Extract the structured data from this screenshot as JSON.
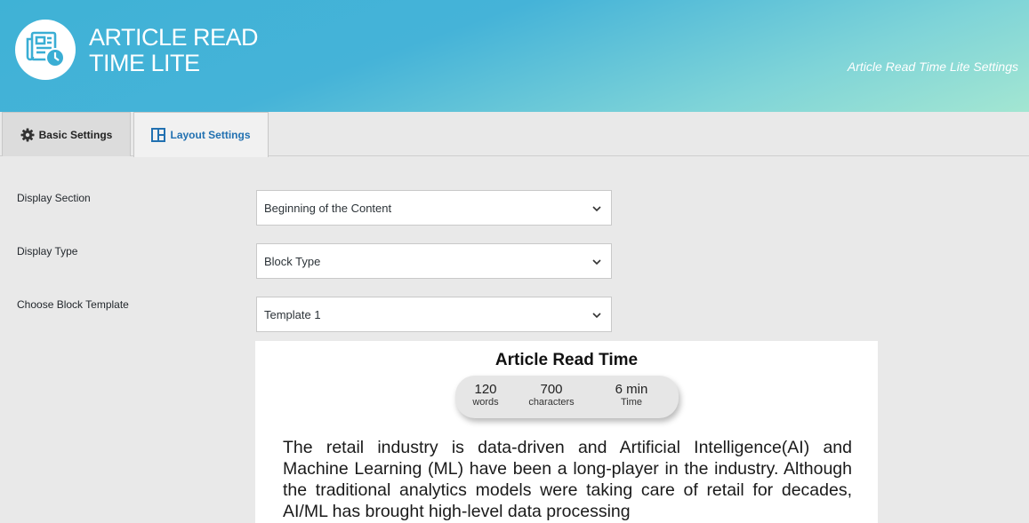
{
  "header": {
    "app_title_line1": "ARTICLE READ",
    "app_title_line2": "TIME LITE",
    "subtitle": "Article Read Time Lite Settings",
    "logo_icon": "newspaper-clock-icon"
  },
  "tabs": [
    {
      "label": "Basic Settings",
      "icon": "gear-icon",
      "active": false
    },
    {
      "label": "Layout Settings",
      "icon": "layout-icon",
      "active": true
    }
  ],
  "form": {
    "display_section": {
      "label": "Display Section",
      "value": "Beginning of the Content"
    },
    "display_type": {
      "label": "Display Type",
      "value": "Block Type"
    },
    "block_template": {
      "label": "Choose Block Template",
      "value": "Template 1"
    }
  },
  "preview": {
    "title": "Article Read Time",
    "stats": [
      {
        "value": "120",
        "label": "words"
      },
      {
        "value": "700",
        "label": "characters"
      },
      {
        "value": "6 min",
        "label": "Time"
      }
    ],
    "body": "The retail industry is data-driven and Artificial Intelligence(AI) and Machine Learning (ML) have been a long-player in the industry. Although the traditional analytics models were taking care of retail for decades, AI/ML has brought high-level data processing"
  },
  "colors": {
    "header_gradient_start": "#3fb2d6",
    "header_gradient_end": "#a3e6d2",
    "active_tab_text": "#2271b1",
    "page_bg": "#e9e9e9"
  }
}
